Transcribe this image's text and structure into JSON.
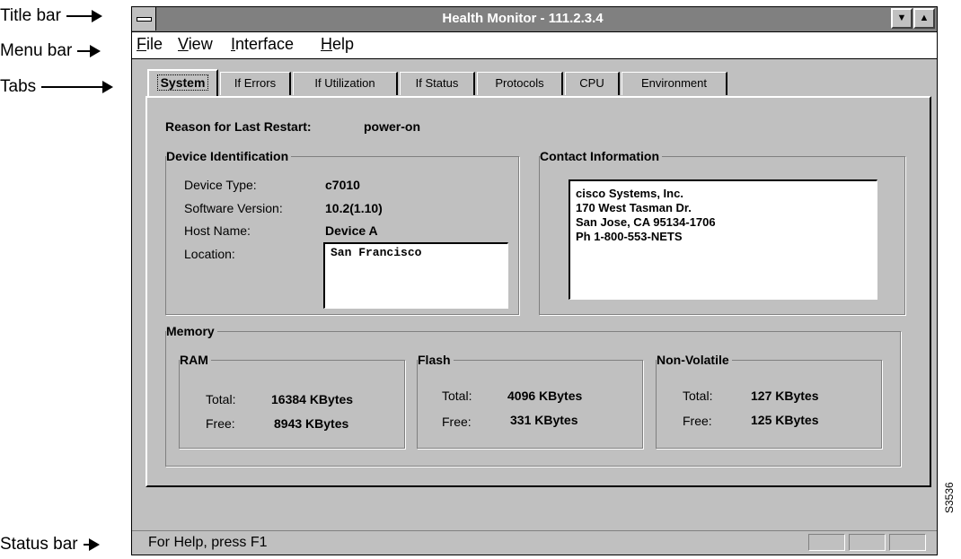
{
  "callouts": {
    "title_bar": "Title bar",
    "menu_bar": "Menu bar",
    "tabs": "Tabs",
    "status_bar": "Status bar"
  },
  "window": {
    "title": "Health Monitor - 111.2.3.4",
    "minimize_glyph": "▼",
    "maximize_glyph": "▲"
  },
  "menu": {
    "file": {
      "ul": "F",
      "rest": "ile"
    },
    "view": {
      "ul": "V",
      "rest": "iew"
    },
    "interface": {
      "ul": "I",
      "rest": "nterface"
    },
    "help": {
      "ul": "H",
      "rest": "elp"
    }
  },
  "tabs": [
    "System",
    "If Errors",
    "If Utilization",
    "If Status",
    "Protocols",
    "CPU",
    "Environment"
  ],
  "system": {
    "restart_label": "Reason for Last Restart:",
    "restart_value": "power-on",
    "device_id": {
      "title": "Device Identification",
      "type_label": "Device Type:",
      "type_value": "c7010",
      "sw_label": "Software Version:",
      "sw_value": "10.2(1.10)",
      "host_label": "Host Name:",
      "host_value": "Device A",
      "location_label": "Location:",
      "location_value": "San Francisco"
    },
    "contact": {
      "title": "Contact Information",
      "lines": [
        "cisco Systems, Inc.",
        "170 West Tasman Dr.",
        "San Jose, CA  95134-1706",
        "Ph 1-800-553-NETS"
      ]
    },
    "memory": {
      "title": "Memory",
      "total_label": "Total:",
      "free_label": "Free:",
      "ram": {
        "title": "RAM",
        "total": "16384 KBytes",
        "free": "8943 KBytes"
      },
      "flash": {
        "title": "Flash",
        "total": "4096 KBytes",
        "free": "331 KBytes"
      },
      "nonvolatile": {
        "title": "Non-Volatile",
        "total": "127 KBytes",
        "free": "125 KBytes"
      }
    }
  },
  "status": {
    "text": "For Help, press F1"
  },
  "figure_code": "S3536"
}
